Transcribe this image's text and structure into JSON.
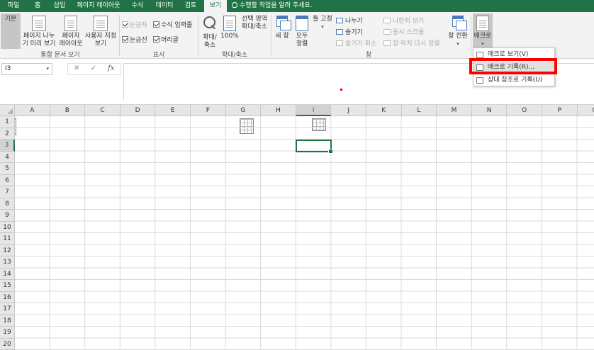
{
  "tabs": [
    {
      "label": "파일",
      "active": false
    },
    {
      "label": "홈",
      "active": false
    },
    {
      "label": "삽입",
      "active": false
    },
    {
      "label": "페이지 레이아웃",
      "active": false
    },
    {
      "label": "수식",
      "active": false
    },
    {
      "label": "데이터",
      "active": false
    },
    {
      "label": "검토",
      "active": false
    },
    {
      "label": "보기",
      "active": true
    }
  ],
  "tell_me": "수행할 작업을 알려 주세요.",
  "ribbon": {
    "workbook_views": {
      "group_label": "통합 문서 보기",
      "normal": "기본",
      "page_break": "페이지 나누\n기 미리 보기",
      "page_layout": "페이지\n레이아웃",
      "custom_views": "사용자 지정\n보기"
    },
    "show": {
      "group_label": "표시",
      "ruler": "눈금자",
      "formula_bar": "수식 입력줄",
      "gridlines": "눈금선",
      "headings": "머리글"
    },
    "zoom": {
      "group_label": "확대/축소",
      "zoom": "확대/\n축소",
      "zoom100": "100%",
      "zoom_selection": "선택 영역\n확대/축소"
    },
    "window": {
      "group_label": "창",
      "new_window": "새 창",
      "arrange_all": "모두\n정렬",
      "freeze_panes": "틀 고정",
      "split": "나누기",
      "hide": "숨기기",
      "unhide": "숨기기 취소",
      "side_by_side": "나란히 보기",
      "sync_scroll": "동시 스크롤",
      "reset_position": "창 위치 다시 정렬",
      "switch_windows": "창 전환"
    },
    "macros": {
      "label": "매크로"
    }
  },
  "macro_menu": {
    "view": "매크로 보기(V)",
    "record": "매크로 기록(R)...",
    "relative": "상대 참조로 기록(U)"
  },
  "formula_bar": {
    "name_box": "I3",
    "cancel": "✕",
    "enter": "✓",
    "fx": "fx",
    "value": ""
  },
  "columns": [
    "A",
    "B",
    "C",
    "D",
    "E",
    "F",
    "G",
    "H",
    "I",
    "J",
    "K",
    "L",
    "M",
    "N",
    "O",
    "P",
    "Q"
  ],
  "rows": [
    "1",
    "2",
    "3",
    "4",
    "5",
    "6",
    "7",
    "8",
    "9",
    "10",
    "11",
    "12",
    "13",
    "14",
    "15",
    "16",
    "17",
    "18",
    "19",
    "20"
  ],
  "active_cell": "I3",
  "colors": {
    "accent": "#217346",
    "highlight": "#ff0000"
  }
}
